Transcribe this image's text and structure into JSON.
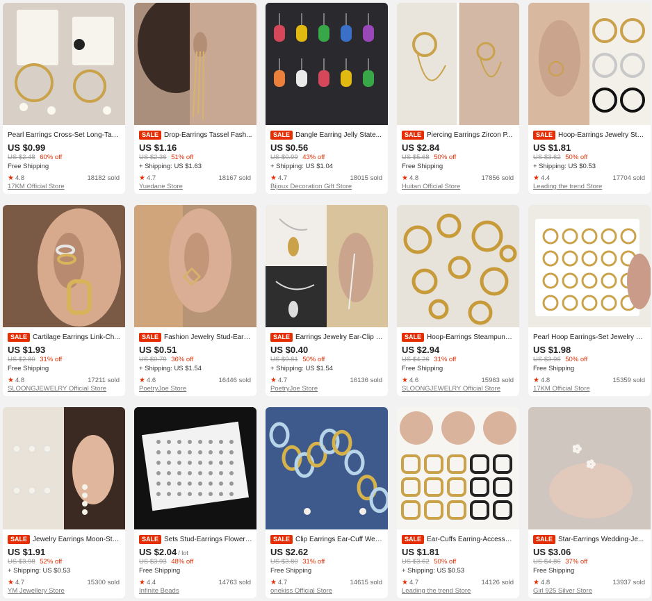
{
  "products": [
    {
      "title": "Pearl Earrings Cross-Set Long-Tass...",
      "sale": false,
      "price": "US $0.99",
      "unit": "",
      "original": "US $2.48",
      "discount": "60% off",
      "shipping": "Free Shipping",
      "rating": "4.8",
      "sold": "18182 sold",
      "store": "17KM Official Store",
      "thumb": {
        "bg": "#d8cfc6",
        "accent": "#c9a24a",
        "icon": "pearl-hoop-set"
      }
    },
    {
      "title": "Drop-Earrings Tassel Fash...",
      "sale": true,
      "price": "US $1.16",
      "unit": "",
      "original": "US $2.36",
      "discount": "51% off",
      "shipping": "+ Shipping: US $1.63",
      "rating": "4.7",
      "sold": "18167 sold",
      "store": "Yuedane Store",
      "thumb": {
        "bg": "#a98f7c",
        "accent": "#d8b46a",
        "icon": "tassel-earring"
      }
    },
    {
      "title": "Dangle Earring Jelly State...",
      "sale": true,
      "price": "US $0.56",
      "unit": "",
      "original": "US $0.99",
      "discount": "43% off",
      "shipping": "+ Shipping: US $1.04",
      "rating": "4.7",
      "sold": "18015 sold",
      "store": "Bijoux Decoration Gift Store",
      "thumb": {
        "bg": "#2a2a2e",
        "accent": "#e84a5f",
        "icon": "gummy-bear-earrings"
      }
    },
    {
      "title": "Piercing Earrings Zircon P...",
      "sale": true,
      "price": "US $2.84",
      "unit": "",
      "original": "US $5.68",
      "discount": "50% off",
      "shipping": "Free Shipping",
      "rating": "4.8",
      "sold": "17856 sold",
      "store": "Huitan Official Store",
      "thumb": {
        "bg": "#e9e4dc",
        "accent": "#c9a24a",
        "icon": "chain-hoop-earring"
      }
    },
    {
      "title": "Hoop-Earrings Jewelry Ste...",
      "sale": true,
      "price": "US $1.81",
      "unit": "",
      "original": "US $3.62",
      "discount": "50% off",
      "shipping": "+ Shipping: US $0.53",
      "rating": "4.4",
      "sold": "17704 sold",
      "store": "Leading the trend Store",
      "thumb": {
        "bg": "#f3efe9",
        "accent": "#caa04a",
        "icon": "hoop-trio"
      }
    },
    {
      "title": "Cartilage Earrings Link-Ch...",
      "sale": true,
      "price": "US $1.93",
      "unit": "",
      "original": "US $2.80",
      "discount": "31% off",
      "shipping": "Free Shipping",
      "rating": "4.8",
      "sold": "17211 sold",
      "store": "SLOONGJEWELRY Official Store",
      "thumb": {
        "bg": "#7a5a45",
        "accent": "#d9b35a",
        "icon": "ear-cuff-stack"
      }
    },
    {
      "title": "Fashion Jewelry Stud-Earri...",
      "sale": true,
      "price": "US $0.51",
      "unit": "",
      "original": "US $0.79",
      "discount": "36% off",
      "shipping": "+ Shipping: US $1.54",
      "rating": "4.6",
      "sold": "16446 sold",
      "store": "PoetryJoe Store",
      "thumb": {
        "bg": "#b89477",
        "accent": "#d7b26a",
        "icon": "square-stud"
      }
    },
    {
      "title": "Earrings Jewelry Ear-Clip P...",
      "sale": true,
      "price": "US $0.40",
      "unit": "",
      "original": "US $0.81",
      "discount": "50% off",
      "shipping": "+ Shipping: US $1.54",
      "rating": "4.7",
      "sold": "16136 sold",
      "store": "PoetryJoe Store",
      "thumb": {
        "bg": "#dcd6cf",
        "accent": "#b9b9b9",
        "icon": "leaf-ear-clip"
      }
    },
    {
      "title": "Hoop-Earrings Steampunk-...",
      "sale": true,
      "price": "US $2.94",
      "unit": "",
      "original": "US $4.26",
      "discount": "31% off",
      "shipping": "Free Shipping",
      "rating": "4.6",
      "sold": "15963 sold",
      "store": "SLOONGJEWELRY Official Store",
      "thumb": {
        "bg": "#e8e3da",
        "accent": "#c79a3a",
        "icon": "gold-hoops-scatter"
      }
    },
    {
      "title": "Pearl Hoop Earrings-Set Jewelry Cir...",
      "sale": false,
      "price": "US $1.98",
      "unit": "",
      "original": "US $3.96",
      "discount": "50% off",
      "shipping": "Free Shipping",
      "rating": "4.8",
      "sold": "15359 sold",
      "store": "17KM Official Store",
      "thumb": {
        "bg": "#eeeae4",
        "accent": "#c9a24a",
        "icon": "pearl-hoop-card"
      }
    },
    {
      "title": "Jewelry Earrings Moon-Sta...",
      "sale": true,
      "price": "US $1.91",
      "unit": "",
      "original": "US $3.98",
      "discount": "52% off",
      "shipping": "+ Shipping: US $0.53",
      "rating": "4.7",
      "sold": "15300 sold",
      "store": "YM Jewellery Store",
      "thumb": {
        "bg": "#d9cfc4",
        "accent": "#f5f2ea",
        "icon": "pearl-drop-earring"
      }
    },
    {
      "title": "Sets Stud-Earrings Flower ...",
      "sale": true,
      "price": "US $2.04",
      "unit": "/ lot",
      "original": "US $3.93",
      "discount": "48% off",
      "shipping": "Free Shipping",
      "rating": "4.4",
      "sold": "14763 sold",
      "store": "Infinite Beads",
      "thumb": {
        "bg": "#111111",
        "accent": "#f2f2f2",
        "icon": "stud-card-set"
      }
    },
    {
      "title": "Clip Earrings Ear-Cuff Wed...",
      "sale": true,
      "price": "US $2.62",
      "unit": "",
      "original": "US $3.80",
      "discount": "31% off",
      "shipping": "Free Shipping",
      "rating": "4.7",
      "sold": "14615 sold",
      "store": "onekiss Official Store",
      "thumb": {
        "bg": "#3e5a8c",
        "accent": "#d6b24a",
        "icon": "ear-cuff-chain"
      }
    },
    {
      "title": "Ear-Cuffs Earring-Accessor...",
      "sale": true,
      "price": "US $1.81",
      "unit": "",
      "original": "US $3.62",
      "discount": "50% off",
      "shipping": "+ Shipping: US $0.53",
      "rating": "4.7",
      "sold": "14126 sold",
      "store": "Leading the trend Store",
      "thumb": {
        "bg": "#f7f5f2",
        "accent": "#c9a24a",
        "icon": "ear-cuff-grid"
      }
    },
    {
      "title": "Star-Earrings Wedding-Je...",
      "sale": true,
      "price": "US $3.06",
      "unit": "",
      "original": "US $4.86",
      "discount": "37% off",
      "shipping": "Free Shipping",
      "rating": "4.8",
      "sold": "13937 sold",
      "store": "Girl 925 Silver Store",
      "thumb": {
        "bg": "#cfc6bf",
        "accent": "#f6f3ee",
        "icon": "flower-stud-fingertip"
      }
    }
  ],
  "labels": {
    "sale_badge": "SALE",
    "rating_star": "★"
  }
}
